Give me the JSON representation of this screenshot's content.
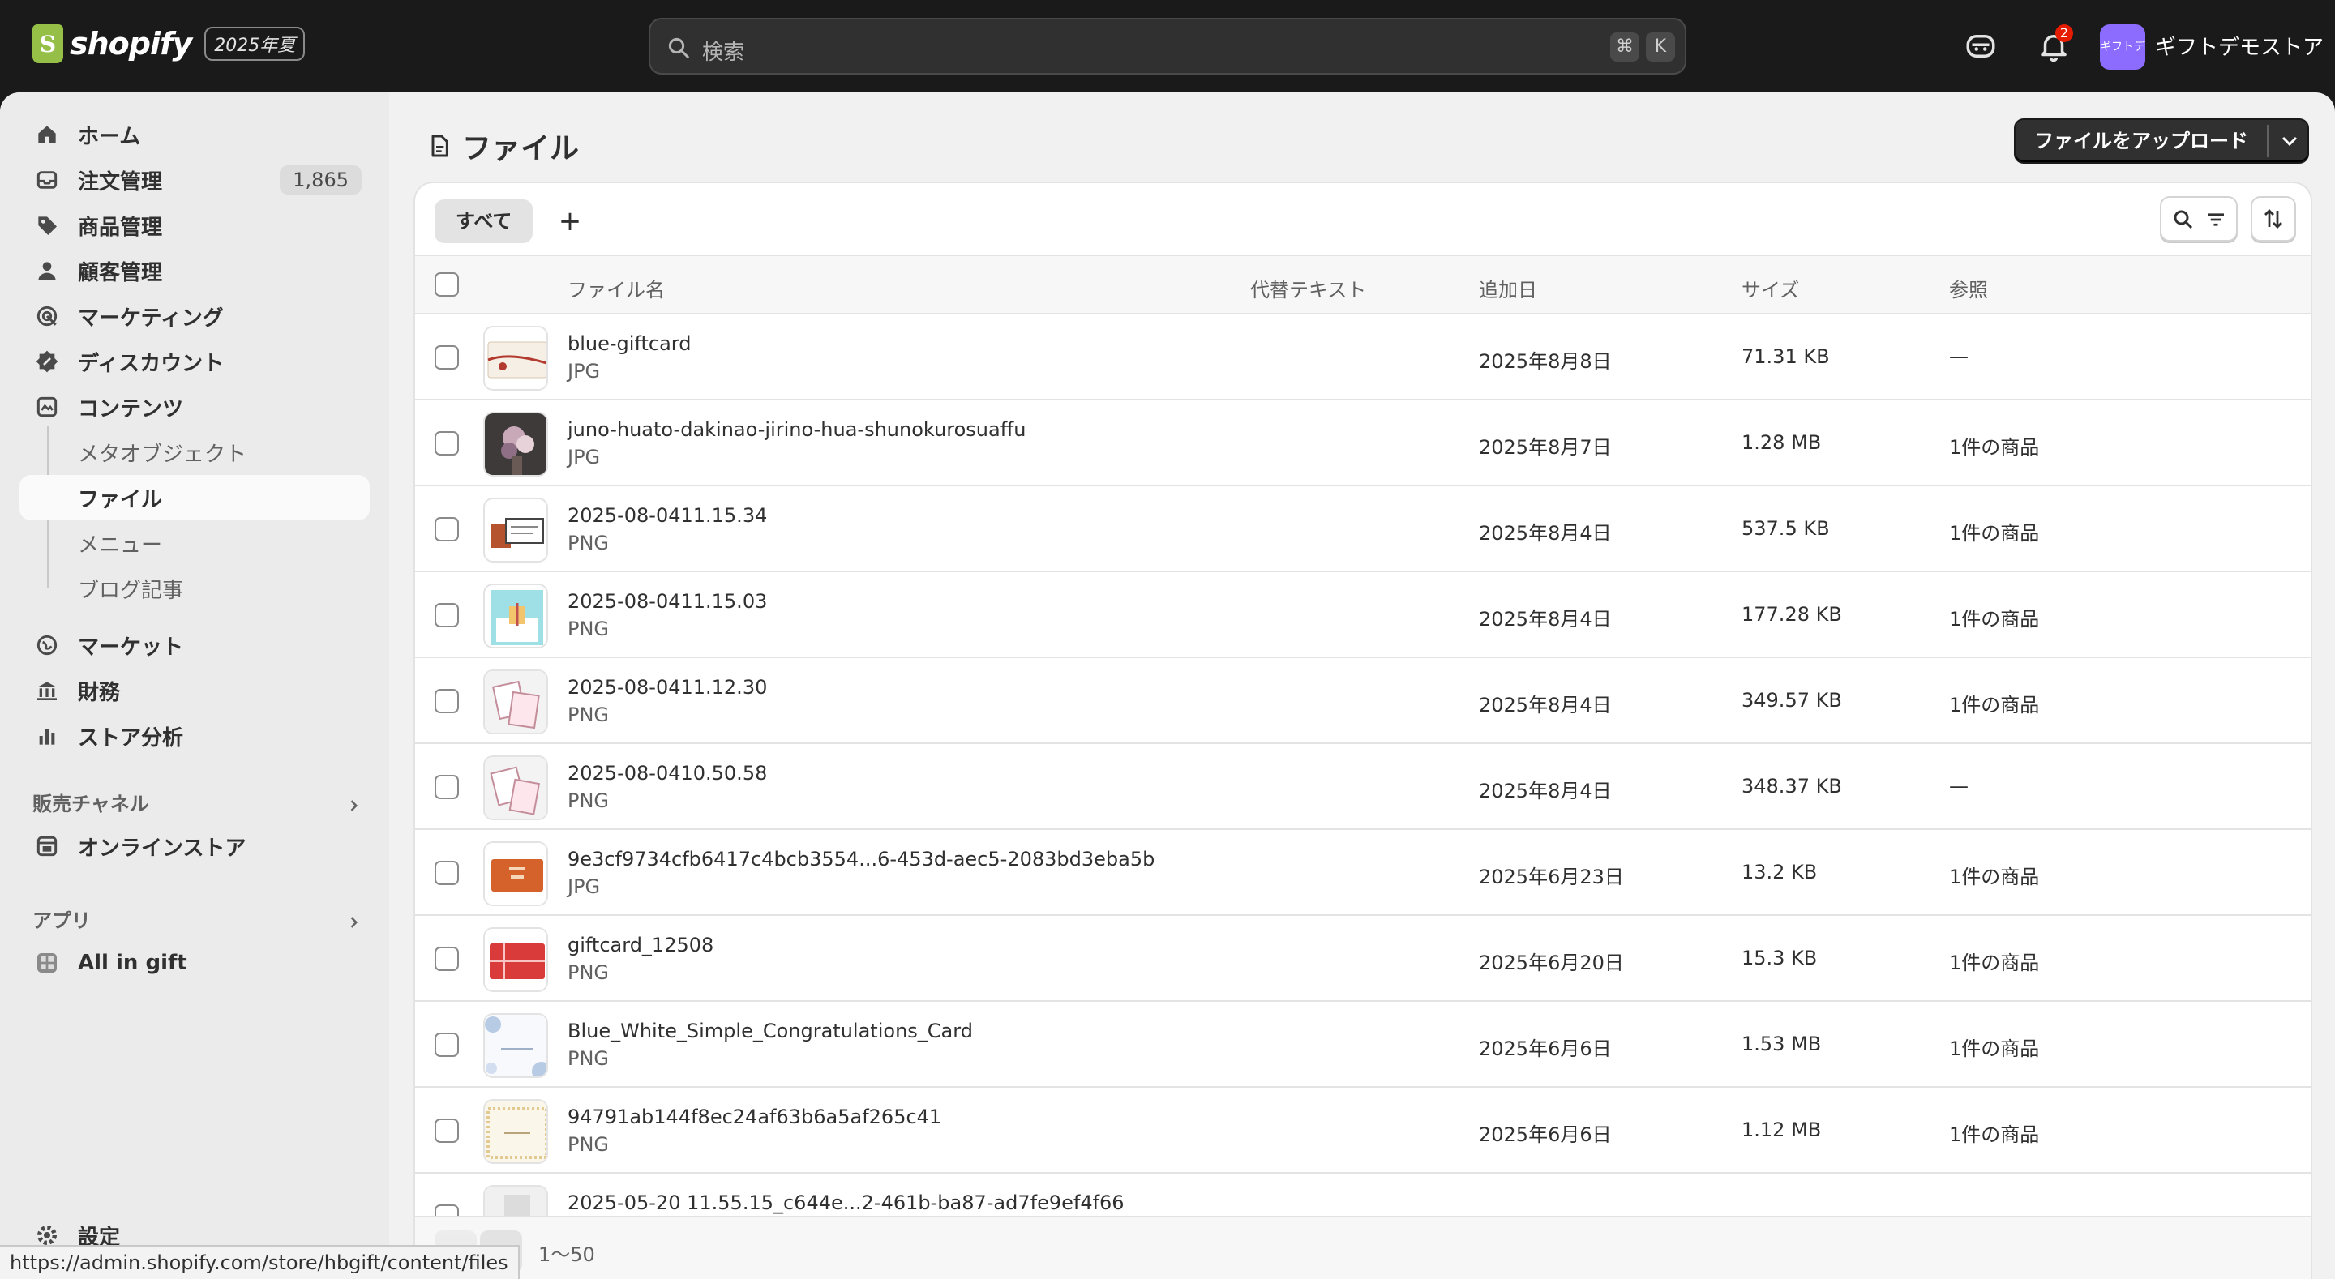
{
  "topbar": {
    "brand": "shopify",
    "edition": "2025年夏",
    "search_placeholder": "検索",
    "kbd_cmd": "⌘",
    "kbd_k": "K",
    "notification_count": "2",
    "store_avatar_text": "ギフトデモ",
    "store_name": "ギフトデモストア"
  },
  "sidebar": {
    "items": [
      {
        "label": "ホーム",
        "icon": "home-icon"
      },
      {
        "label": "注文管理",
        "icon": "inbox-icon",
        "count": "1,865"
      },
      {
        "label": "商品管理",
        "icon": "tag-icon"
      },
      {
        "label": "顧客管理",
        "icon": "person-icon"
      },
      {
        "label": "マーケティング",
        "icon": "target-icon"
      },
      {
        "label": "ディスカウント",
        "icon": "discount-icon"
      },
      {
        "label": "コンテンツ",
        "icon": "content-icon"
      }
    ],
    "content_sub": [
      "メタオブジェクト",
      "ファイル",
      "メニュー",
      "ブログ記事"
    ],
    "items2": [
      {
        "label": "マーケット",
        "icon": "globe-icon"
      },
      {
        "label": "財務",
        "icon": "bank-icon"
      },
      {
        "label": "ストア分析",
        "icon": "bar-chart-icon"
      }
    ],
    "sales_channels_heading": "販売チャネル",
    "online_store": "オンラインストア",
    "apps_heading": "アプリ",
    "app_item": "All in gift",
    "settings": "設定"
  },
  "status_url": "https://admin.shopify.com/store/hbgift/content/files",
  "page": {
    "title": "ファイル",
    "upload_button": "ファイルをアップロード",
    "tab_all": "すべて",
    "tab_add": "+"
  },
  "table": {
    "columns": [
      "ファイル名",
      "代替テキスト",
      "追加日",
      "サイズ",
      "参照"
    ],
    "rows": [
      {
        "name": "blue-giftcard",
        "type": "JPG",
        "alt": "",
        "date": "2025年8月8日",
        "size": "71.31 KB",
        "ref": "—"
      },
      {
        "name": "juno-huato-dakinao-jirino-hua-shunokurosuaffu",
        "type": "JPG",
        "alt": "",
        "date": "2025年8月7日",
        "size": "1.28 MB",
        "ref": "1件の商品"
      },
      {
        "name": "2025-08-0411.15.34",
        "type": "PNG",
        "alt": "",
        "date": "2025年8月4日",
        "size": "537.5 KB",
        "ref": "1件の商品"
      },
      {
        "name": "2025-08-0411.15.03",
        "type": "PNG",
        "alt": "",
        "date": "2025年8月4日",
        "size": "177.28 KB",
        "ref": "1件の商品"
      },
      {
        "name": "2025-08-0411.12.30",
        "type": "PNG",
        "alt": "",
        "date": "2025年8月4日",
        "size": "349.57 KB",
        "ref": "1件の商品"
      },
      {
        "name": "2025-08-0410.50.58",
        "type": "PNG",
        "alt": "",
        "date": "2025年8月4日",
        "size": "348.37 KB",
        "ref": "—"
      },
      {
        "name": "9e3cf9734cfb6417c4bcb3554...6-453d-aec5-2083bd3eba5b",
        "type": "JPG",
        "alt": "",
        "date": "2025年6月23日",
        "size": "13.2 KB",
        "ref": "1件の商品"
      },
      {
        "name": "giftcard_12508",
        "type": "PNG",
        "alt": "",
        "date": "2025年6月20日",
        "size": "15.3 KB",
        "ref": "1件の商品"
      },
      {
        "name": "Blue_White_Simple_Congratulations_Card",
        "type": "PNG",
        "alt": "",
        "date": "2025年6月6日",
        "size": "1.53 MB",
        "ref": "1件の商品"
      },
      {
        "name": "94791ab144f8ec24af63b6a5af265c41",
        "type": "PNG",
        "alt": "",
        "date": "2025年6月6日",
        "size": "1.12 MB",
        "ref": "1件の商品"
      },
      {
        "name": "2025-05-20 11.55.15_c644e...2-461b-ba87-ad7fe9ef4f66",
        "type": "",
        "alt": "",
        "date": "",
        "size": "",
        "ref": ""
      }
    ]
  },
  "pagination": {
    "label": "1〜50"
  },
  "colors": {
    "topbar": "#1a1a1a",
    "accent_avatar": "#8b6cff",
    "badge": "#e51c00",
    "primary_button": "#303030"
  }
}
